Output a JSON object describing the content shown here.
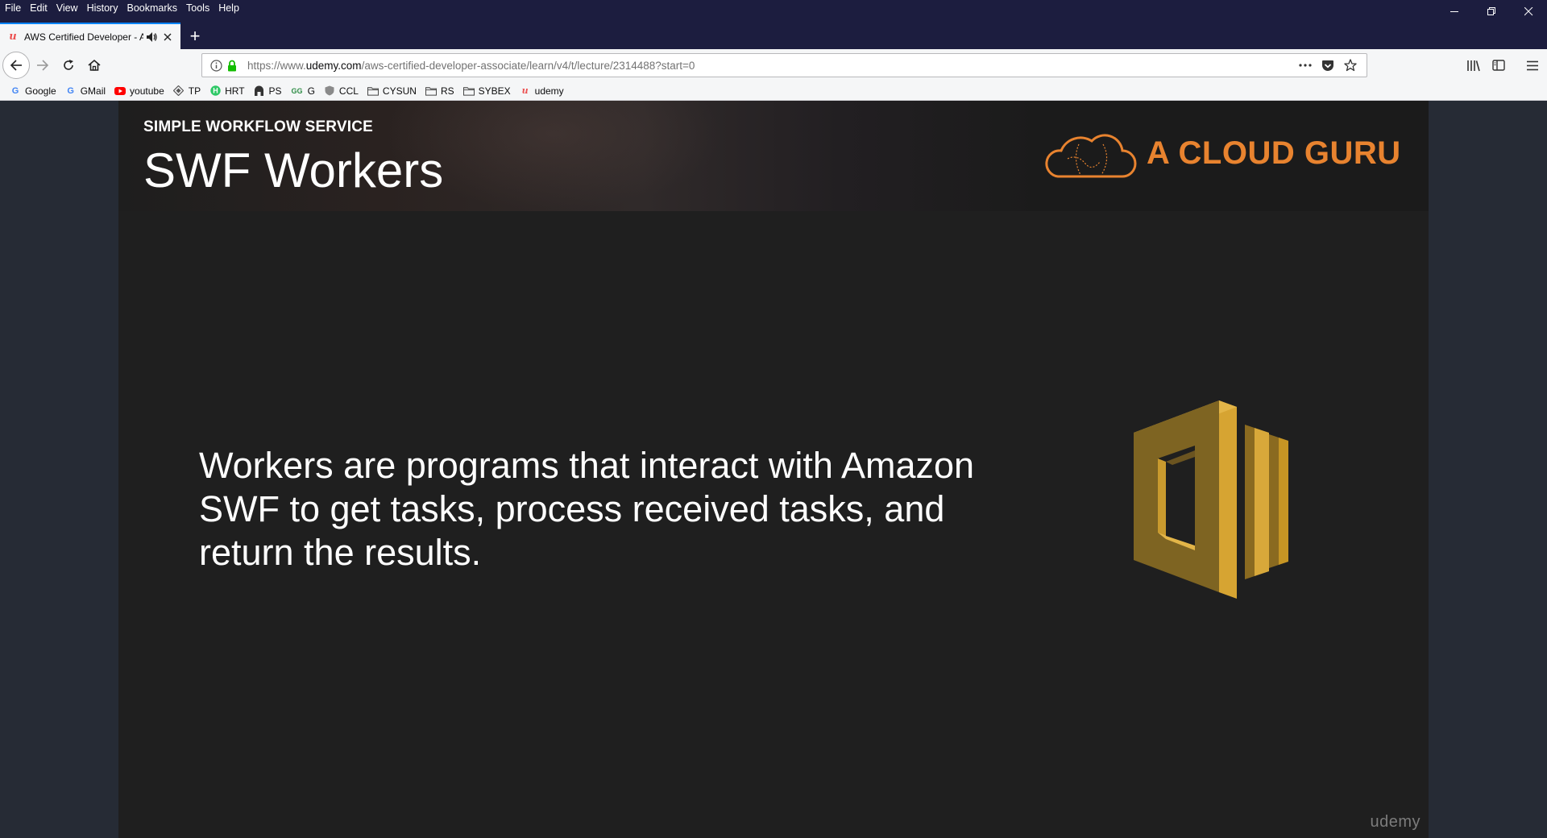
{
  "menu": [
    "File",
    "Edit",
    "View",
    "History",
    "Bookmarks",
    "Tools",
    "Help"
  ],
  "window_controls": {
    "minimize": "–",
    "restore": "❐",
    "close": "✕"
  },
  "tab": {
    "favicon": "udemy-icon",
    "title": "AWS Certified Developer - A",
    "audio_icon": "speaker-icon",
    "close_icon": "close-icon"
  },
  "newtab_label": "+",
  "url": {
    "prefix": "https://www.",
    "domain": "udemy.com",
    "path": "/aws-certified-developer-associate/learn/v4/t/lecture/2314488?start=0"
  },
  "bookmarks": [
    {
      "label": "Google",
      "icon": "google-icon",
      "color": "#4285f4"
    },
    {
      "label": "GMail",
      "icon": "google-icon",
      "color": "#4285f4"
    },
    {
      "label": "youtube",
      "icon": "youtube-icon",
      "color": "#ff0000"
    },
    {
      "label": "TP",
      "icon": "diamond-icon",
      "color": "#555555"
    },
    {
      "label": "HRT",
      "icon": "hackerrank-icon",
      "color": "#2ec866"
    },
    {
      "label": "PS",
      "icon": "building-icon",
      "color": "#333333"
    },
    {
      "label": "G",
      "icon": "geeks-icon",
      "color": "#2f8d46"
    },
    {
      "label": "CCL",
      "icon": "shield-icon",
      "color": "#777777"
    },
    {
      "label": "CYSUN",
      "icon": "folder-icon",
      "color": "#555555"
    },
    {
      "label": "RS",
      "icon": "folder-icon",
      "color": "#555555"
    },
    {
      "label": "SYBEX",
      "icon": "folder-icon",
      "color": "#555555"
    },
    {
      "label": "udemy",
      "icon": "udemy-icon",
      "color": "#ec5252"
    }
  ],
  "slide": {
    "kicker": "SIMPLE WORKFLOW SERVICE",
    "title": "SWF Workers",
    "brand": "A CLOUD GURU",
    "body": "Workers are programs that interact with Amazon SWF to get tasks, process received tasks, and return the results.",
    "watermark": "udemy"
  },
  "colors": {
    "accent": "#0a84ff",
    "brand_orange": "#e8832f",
    "swf_gold": "#d5a32e"
  }
}
